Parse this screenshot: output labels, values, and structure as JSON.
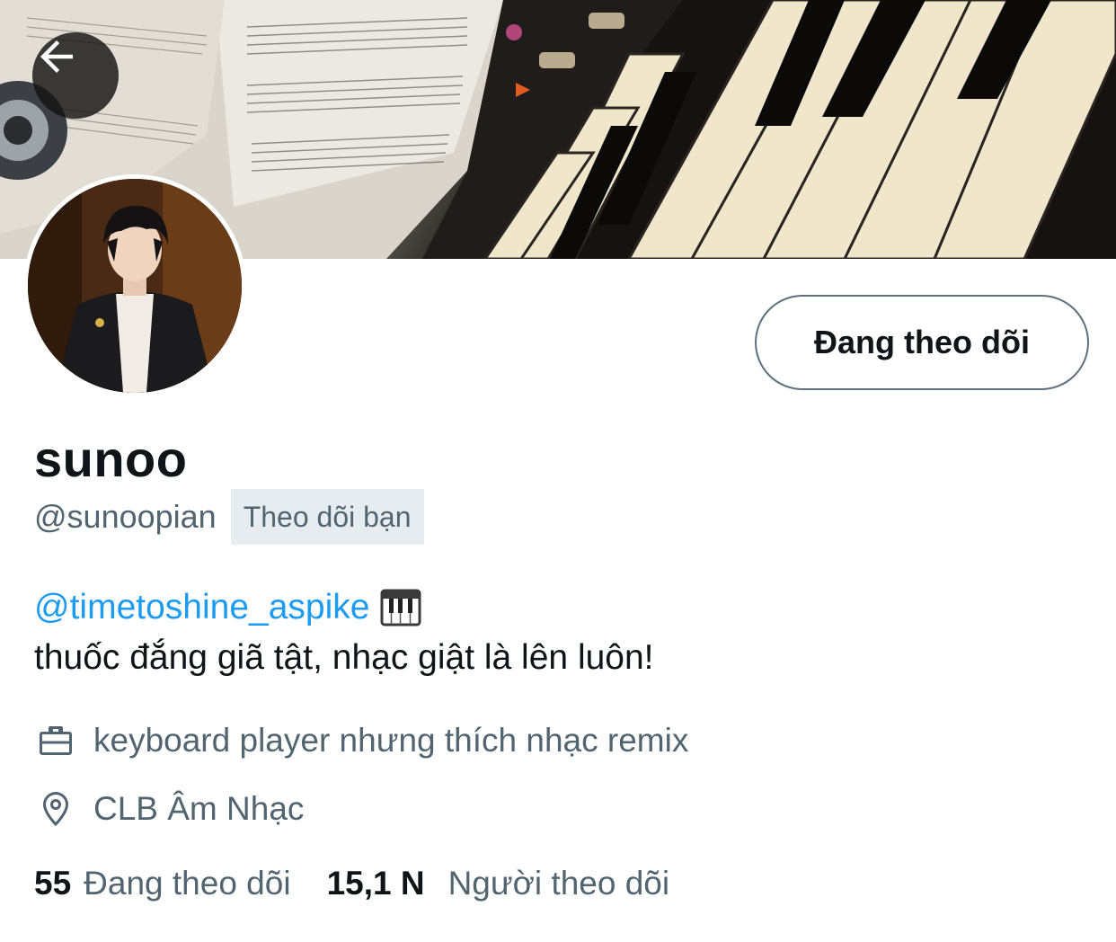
{
  "header": {
    "back_icon": "arrow-left-icon",
    "banner_alt": "piano keyboard with sheet music"
  },
  "profile": {
    "display_name": "sunoo",
    "handle": "@sunoopian",
    "follows_you_badge": "Theo dõi bạn",
    "follow_button_label": "Đang theo dõi",
    "bio_mention": "@timetoshine_aspike",
    "bio_emoji": "piano-keys-emoji",
    "bio_text": "thuốc đắng giã tật, nhạc giật là lên luôn!",
    "profession": "keyboard player nhưng thích nhạc remix",
    "location": "CLB Âm Nhạc"
  },
  "stats": {
    "following_count": "55",
    "following_label": "Đang theo dõi",
    "followers_count": "15,1 N",
    "followers_label": "Người theo dõi"
  },
  "colors": {
    "link": "#1d9bf0",
    "secondary_text": "#536471",
    "primary_text": "#0f1419",
    "badge_bg": "#e6ecf0"
  }
}
